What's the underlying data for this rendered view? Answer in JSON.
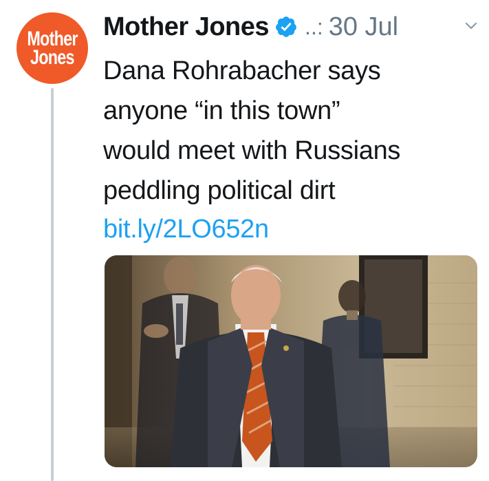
{
  "tweet": {
    "author_name": "Mother Jones",
    "handle": "..:",
    "date": "30 Jul",
    "text_lines": [
      "Dana Rohrabacher says",
      "anyone “in this town”",
      "would meet with Russians",
      "peddling political dirt"
    ],
    "link": "bit.ly/2LO652n"
  },
  "avatar": {
    "line1": "Mother",
    "line2": "Jones"
  },
  "icons": {
    "verified": "verified-badge-icon",
    "caret": "chevron-down-icon"
  },
  "colors": {
    "brand": "#f05a28",
    "link": "#1da1f2",
    "verified": "#1da1f2",
    "muted": "#657786"
  }
}
